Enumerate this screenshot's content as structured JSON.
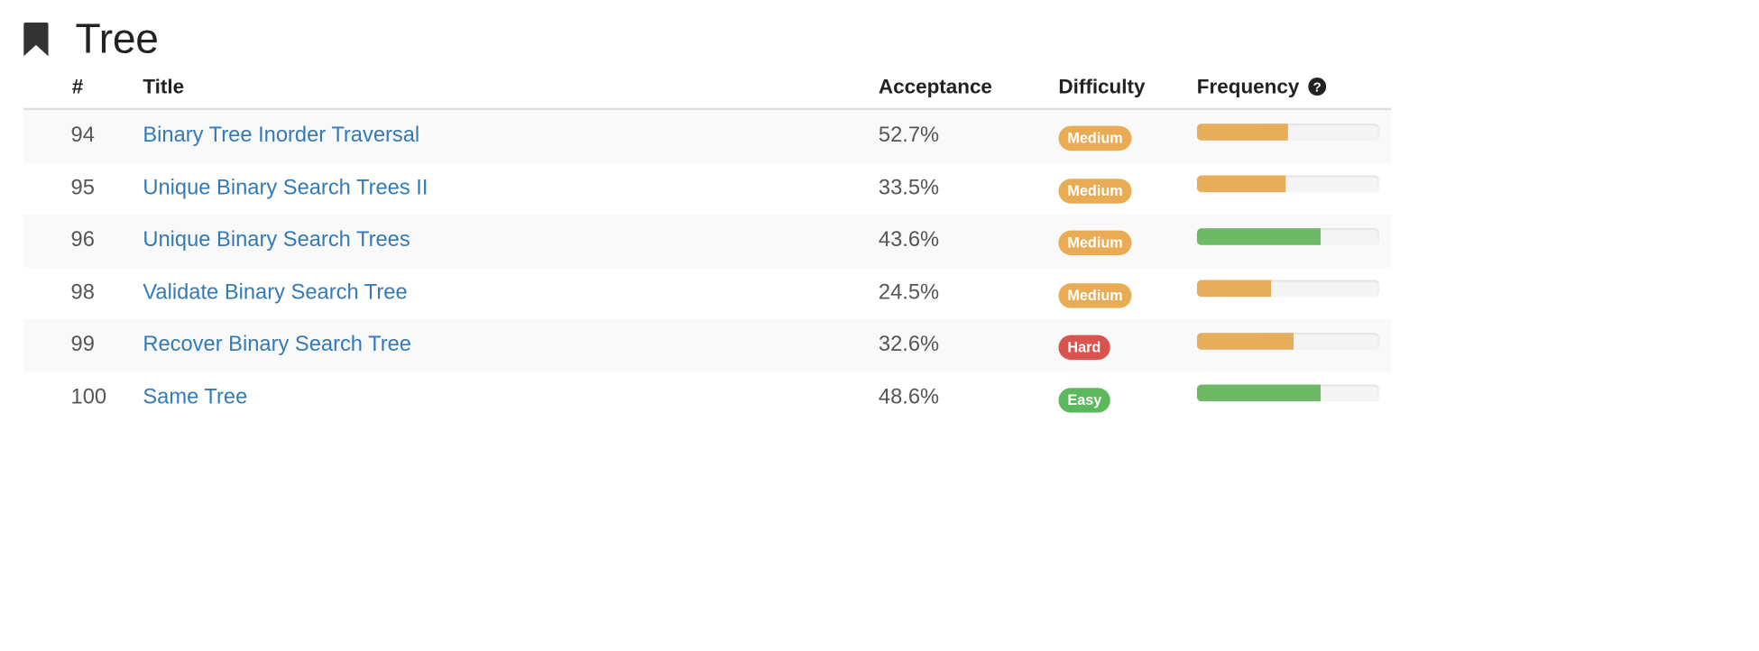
{
  "heading": {
    "title": "Tree",
    "icon": "bookmark-icon"
  },
  "table": {
    "headers": {
      "num": "#",
      "title": "Title",
      "acceptance": "Acceptance",
      "difficulty": "Difficulty",
      "frequency": "Frequency",
      "frequency_help_icon": "question-circle-icon"
    },
    "rows": [
      {
        "num": "94",
        "title": "Binary Tree Inorder Traversal",
        "acceptance": "52.7%",
        "difficulty": "Medium",
        "difficulty_level": "medium",
        "frequency": 0.5,
        "frequency_color": "#e7ad5a"
      },
      {
        "num": "95",
        "title": "Unique Binary Search Trees II",
        "acceptance": "33.5%",
        "difficulty": "Medium",
        "difficulty_level": "medium",
        "frequency": 0.49,
        "frequency_color": "#e7ad5a"
      },
      {
        "num": "96",
        "title": "Unique Binary Search Trees",
        "acceptance": "43.6%",
        "difficulty": "Medium",
        "difficulty_level": "medium",
        "frequency": 0.68,
        "frequency_color": "#6db966"
      },
      {
        "num": "98",
        "title": "Validate Binary Search Tree",
        "acceptance": "24.5%",
        "difficulty": "Medium",
        "difficulty_level": "medium",
        "frequency": 0.41,
        "frequency_color": "#e7ad5a"
      },
      {
        "num": "99",
        "title": "Recover Binary Search Tree",
        "acceptance": "32.6%",
        "difficulty": "Hard",
        "difficulty_level": "hard",
        "frequency": 0.53,
        "frequency_color": "#e7ad5a"
      },
      {
        "num": "100",
        "title": "Same Tree",
        "acceptance": "48.6%",
        "difficulty": "Easy",
        "difficulty_level": "easy",
        "frequency": 0.68,
        "frequency_color": "#6db966"
      }
    ]
  },
  "colors": {
    "link": "#337ab7",
    "medium": "#e9ac55",
    "hard": "#d9534f",
    "easy": "#5cb85c"
  }
}
